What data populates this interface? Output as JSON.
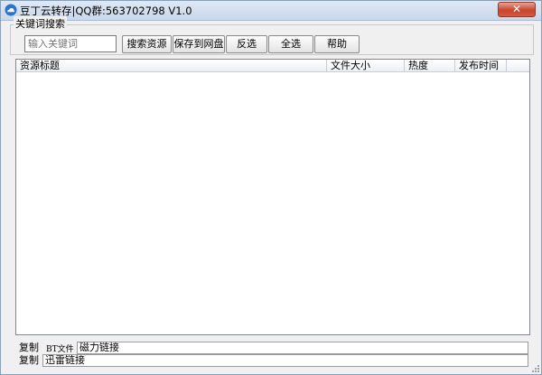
{
  "window": {
    "title": "豆丁云转存|QQ群:563702798  V1.0",
    "close_label": "✕"
  },
  "search_group": {
    "legend": "关键词搜索",
    "keyword_placeholder": "输入关键词",
    "keyword_value": ""
  },
  "toolbar": {
    "search_label": "搜索资源",
    "save_label": "保存到网盘",
    "invert_label": "反选",
    "select_all_label": "全选",
    "help_label": "帮助"
  },
  "table": {
    "columns": [
      "资源标题",
      "文件大小",
      "热度",
      "发布时间"
    ],
    "rows": []
  },
  "bottom": {
    "copy_label_1": "复制",
    "bt_tag": "BT文件",
    "magnet_label": "磁力链接",
    "copy_label_2": "复制",
    "thunder_label": "迅雷链接"
  },
  "colors": {
    "accent": "#c7432c",
    "titlebar": "#c9d8ec"
  }
}
